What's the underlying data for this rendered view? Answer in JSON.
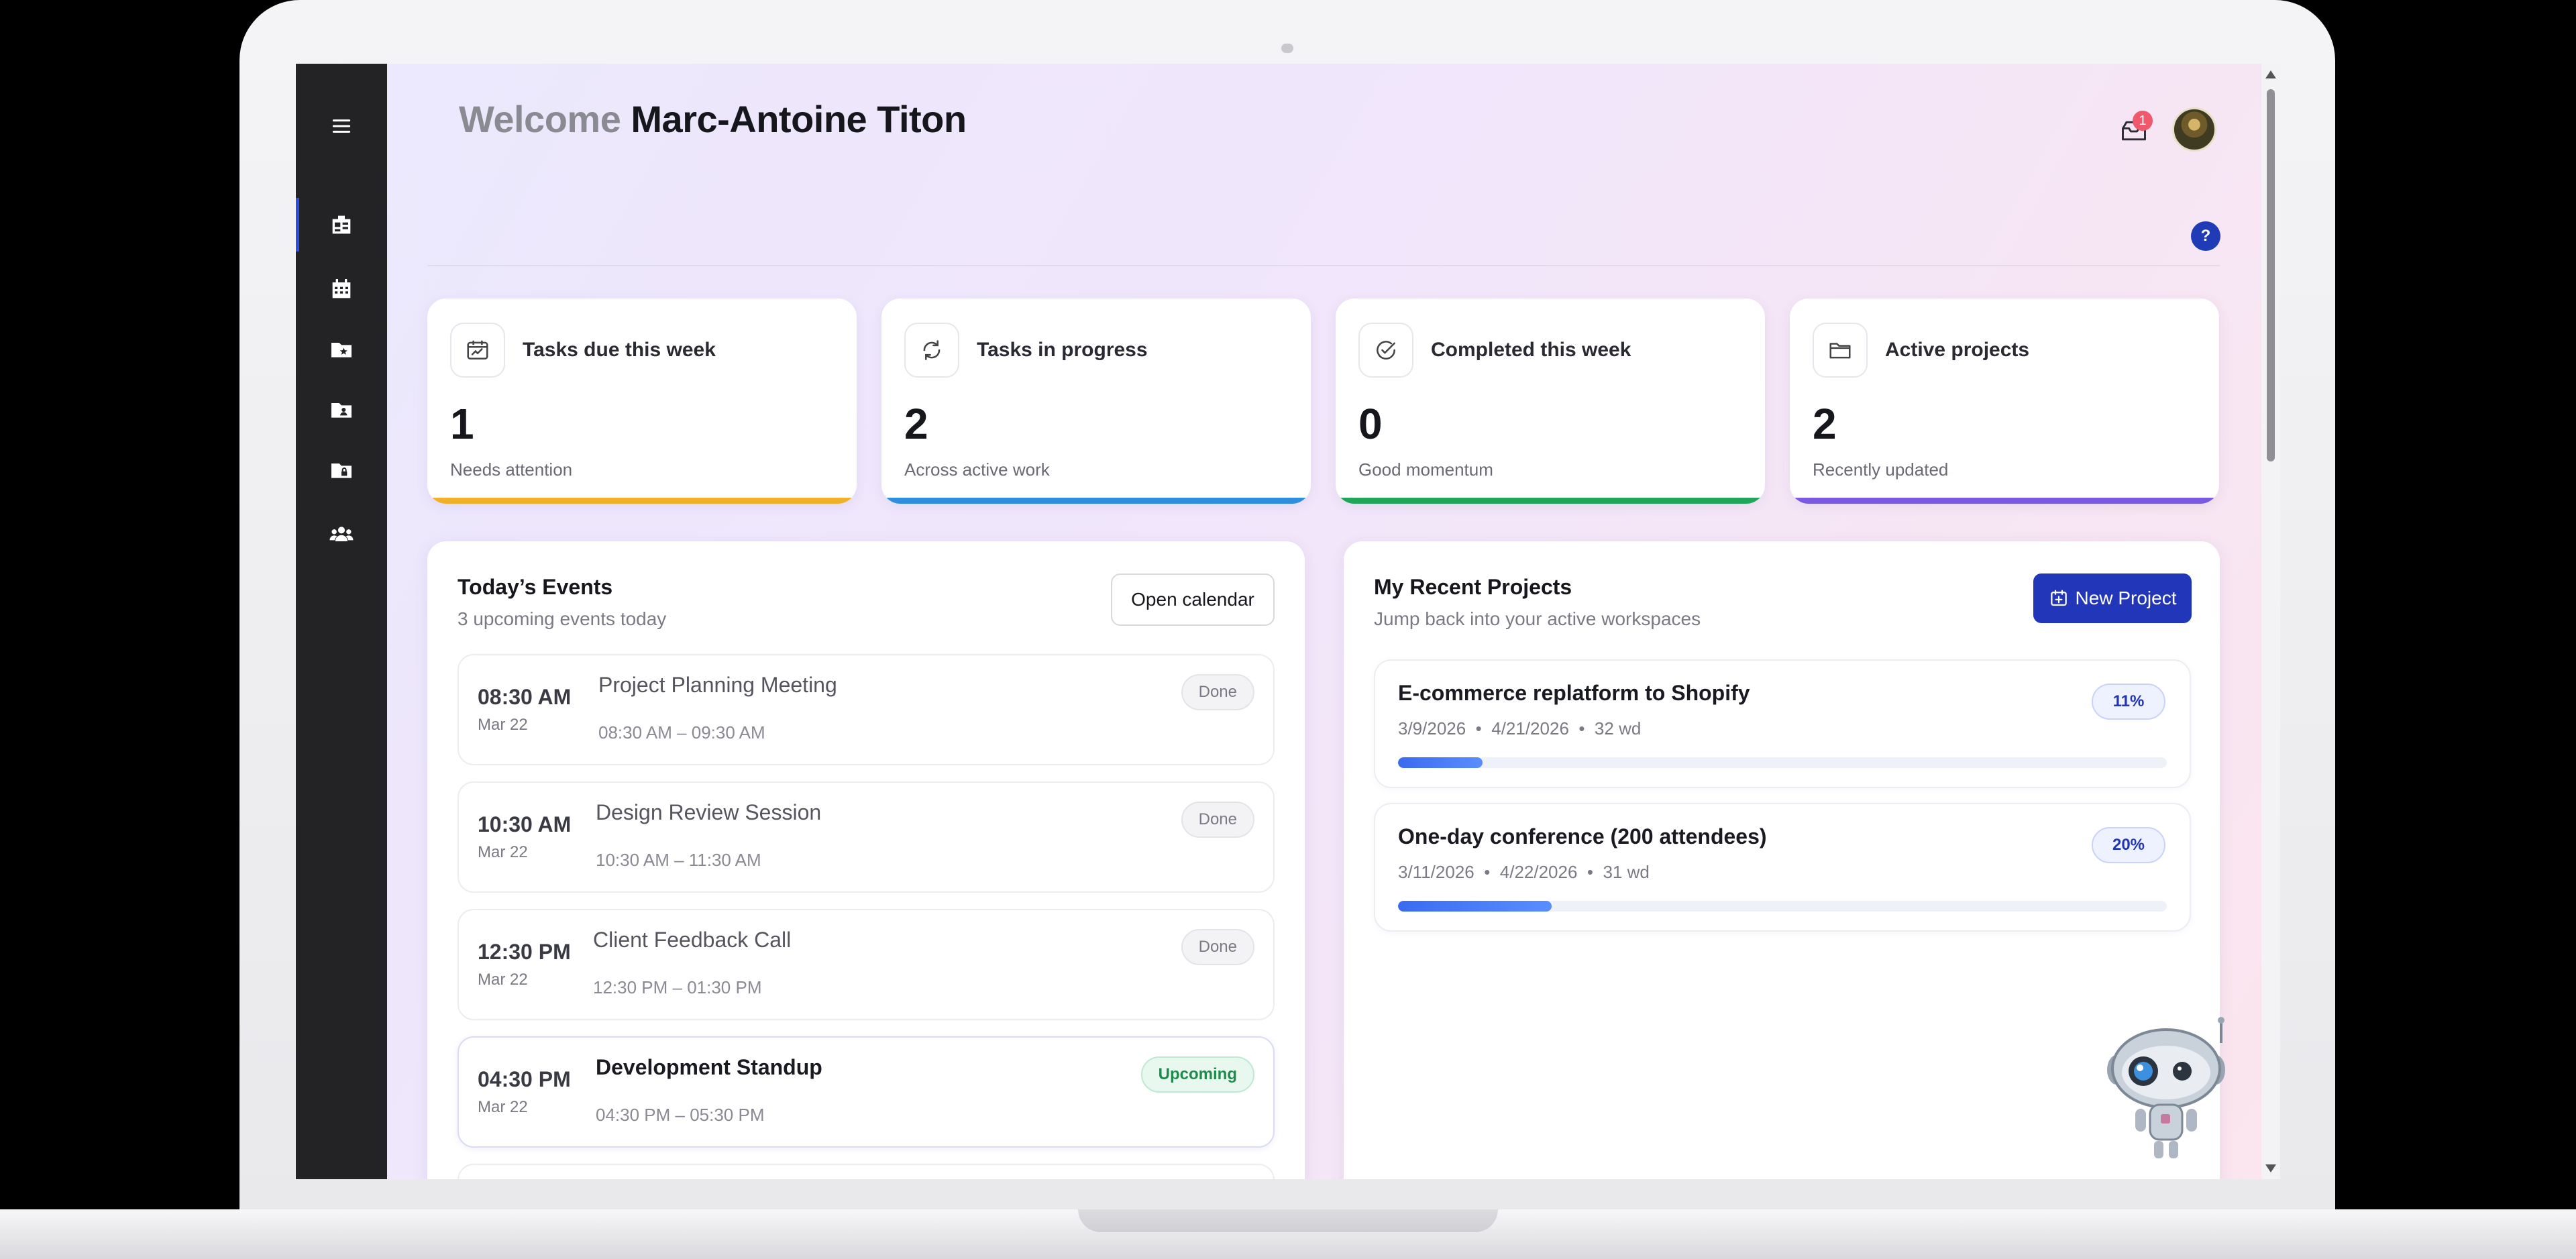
{
  "header": {
    "welcome_prefix": "Welcome",
    "user_name": "Marc-Antoine Titon",
    "mail_badge": "1",
    "help_label": "?"
  },
  "sidebar": {
    "items": [
      {
        "icon": "menu-icon"
      },
      {
        "icon": "dashboard-icon",
        "active": true
      },
      {
        "icon": "calendar-icon"
      },
      {
        "icon": "starred-folder-icon"
      },
      {
        "icon": "shared-folder-icon"
      },
      {
        "icon": "locked-folder-icon"
      },
      {
        "icon": "team-icon"
      }
    ]
  },
  "stats": [
    {
      "title": "Tasks due this week",
      "value": "1",
      "sub": "Needs attention",
      "icon": "calendar-chart-icon",
      "color": "#f0b02a"
    },
    {
      "title": "Tasks in progress",
      "value": "2",
      "sub": "Across active work",
      "icon": "refresh-icon",
      "color": "#2e8fe0"
    },
    {
      "title": "Completed this week",
      "value": "0",
      "sub": "Good momentum",
      "icon": "check-circle-icon",
      "color": "#21a55a"
    },
    {
      "title": "Active projects",
      "value": "2",
      "sub": "Recently updated",
      "icon": "folder-icon",
      "color": "#7a5ae0"
    }
  ],
  "events_panel": {
    "title": "Today’s Events",
    "subtitle": "3 upcoming events today",
    "open_calendar_label": "Open calendar",
    "events": [
      {
        "time": "08:30 AM",
        "date": "Mar 22",
        "title": "Project Planning Meeting",
        "range": "08:30 AM – 09:30 AM",
        "status": "Done"
      },
      {
        "time": "10:30 AM",
        "date": "Mar 22",
        "title": "Design Review Session",
        "range": "10:30 AM – 11:30 AM",
        "status": "Done"
      },
      {
        "time": "12:30 PM",
        "date": "Mar 22",
        "title": "Client Feedback Call",
        "range": "12:30 PM – 01:30 PM",
        "status": "Done"
      },
      {
        "time": "04:30 PM",
        "date": "Mar 22",
        "title": "Development Standup",
        "range": "04:30 PM – 05:30 PM",
        "status": "Upcoming"
      }
    ]
  },
  "projects_panel": {
    "title": "My Recent Projects",
    "subtitle": "Jump back into your active workspaces",
    "new_project_label": "New Project",
    "separator": "•",
    "projects": [
      {
        "name": "E-commerce replatform to Shopify",
        "start": "3/9/2026",
        "end": "4/21/2026",
        "duration": "32 wd",
        "progress_label": "11%",
        "progress": 0.11
      },
      {
        "name": "One-day conference (200 attendees)",
        "start": "3/11/2026",
        "end": "4/22/2026",
        "duration": "31 wd",
        "progress_label": "20%",
        "progress": 0.2
      }
    ]
  },
  "colors": {
    "accent": "#2136b8",
    "sidebar_bg": "#232326"
  }
}
